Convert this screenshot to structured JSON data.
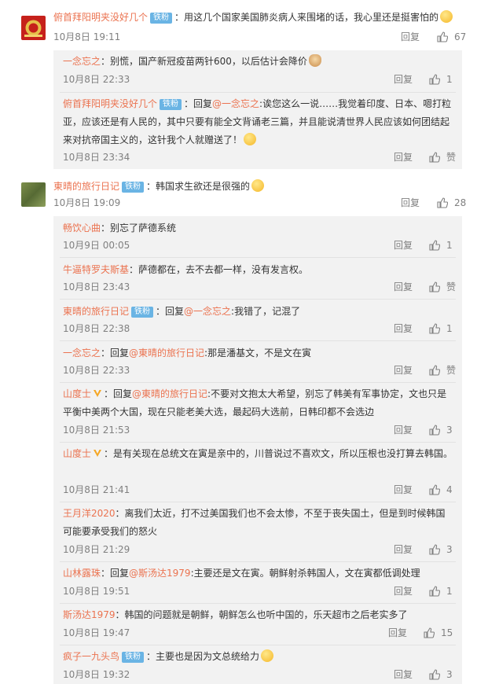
{
  "comments": [
    {
      "user": "俯首拜阳明夹没好几个",
      "tag": "铁粉",
      "text": "：用这几个国家美国肺炎病人来围堵的话，我心里还是挺害怕的",
      "time": "10月8日 19:11",
      "reply_label": "回复",
      "likes": "67",
      "replies": [
        {
          "user": "一念忘之",
          "tag": "",
          "mid": "",
          "at": "",
          "text": "：别慌，国产新冠疫苗两针600，以后估计会降价",
          "time": "10月8日 22:33",
          "reply_label": "回复",
          "likes": "1"
        },
        {
          "user": "俯首拜阳明夹没好几个",
          "tag": "铁粉",
          "mid": "：回复",
          "at": "@一念忘之",
          "text": ":诶您这么一说……我觉着印度、日本、嗯打粒亚，应该还是有人民的，其中只要有能全文背诵老三篇，并且能说清世界人民应该如何团结起来对抗帝国主义的，这针我个人就赠送了！",
          "time": "10月8日 23:34",
          "reply_label": "回复",
          "likes": "赞"
        }
      ]
    },
    {
      "user": "東晴的旅行日记",
      "tag": "铁粉",
      "text": "：韩国求生欲还是很强的",
      "time": "10月8日 19:09",
      "reply_label": "回复",
      "likes": "28",
      "replies": [
        {
          "user": "畅饮心曲",
          "tag": "",
          "mid": "",
          "at": "",
          "text": "：别忘了萨德系统",
          "time": "10月9日 00:05",
          "reply_label": "回复",
          "likes": "1"
        },
        {
          "user": "牛逼特罗夫斯基",
          "tag": "",
          "mid": "",
          "at": "",
          "text": "：萨德都在，去不去都一样，没有发言权。",
          "time": "10月8日 23:43",
          "reply_label": "回复",
          "likes": "赞"
        },
        {
          "user": "東晴的旅行日记",
          "tag": "铁粉",
          "mid": "：回复",
          "at": "@一念忘之",
          "text": ":我错了，记混了",
          "time": "10月8日 22:38",
          "reply_label": "回复",
          "likes": "1"
        },
        {
          "user": "一念忘之",
          "tag": "",
          "mid": "：回复",
          "at": "@東晴的旅行日记",
          "text": ":那是潘基文，不是文在寅",
          "time": "10月8日 22:33",
          "reply_label": "回复",
          "likes": "赞"
        },
        {
          "user": "山度士",
          "tag": "",
          "verified": true,
          "mid": "：回复",
          "at": "@東晴的旅行日记",
          "text": ":不要对文抱太大希望，别忘了韩美有军事协定，文也只是平衡中美两个大国，现在只能老美大选，最起码大选前，日韩印都不会选边",
          "time": "10月8日 21:53",
          "reply_label": "回复",
          "likes": "3"
        },
        {
          "user": "山度士",
          "tag": "",
          "verified": true,
          "mid": "",
          "at": "",
          "text": "：是有关现在总统文在寅是亲中的，川普说过不喜欢文，所以压根也没打算去韩国。",
          "time": "10月8日 21:41",
          "reply_label": "回复",
          "likes": "4"
        },
        {
          "user": "王月洋2020",
          "tag": "",
          "mid": "",
          "at": "",
          "text": "：离我们太近，打不过美国我们也不会太惨，不至于丧失国土，但是到时候韩国可能要承受我们的怒火",
          "time": "10月8日 21:29",
          "reply_label": "回复",
          "likes": "3"
        },
        {
          "user": "山林露珠",
          "tag": "",
          "mid": "：回复",
          "at": "@斯汤达1979",
          "text": ":主要还是文在寅。朝鲜射杀韩国人，文在寅都低调处理",
          "time": "10月8日 19:51",
          "reply_label": "回复",
          "likes": "1"
        },
        {
          "user": "斯汤达1979",
          "tag": "",
          "mid": "",
          "at": "",
          "text": "：韩国的问题就是朝鲜，朝鲜怎么也听中国的，乐天超市之后老实多了",
          "time": "10月8日 19:47",
          "reply_label": "回复",
          "likes": "15"
        },
        {
          "user": "疯子一九头鸟",
          "tag": "铁粉",
          "mid": "",
          "at": "",
          "text": "：主要也是因为文总统给力",
          "time": "10月8日 19:32",
          "reply_label": "回复",
          "likes": "3"
        }
      ]
    }
  ]
}
